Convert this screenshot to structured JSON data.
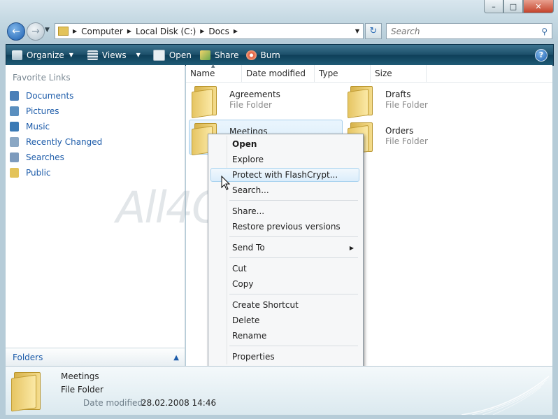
{
  "address": {
    "segments": [
      "Computer",
      "Local Disk (C:)",
      "Docs"
    ]
  },
  "search": {
    "placeholder": "Search"
  },
  "toolbar": {
    "organize": "Organize",
    "views": "Views",
    "open": "Open",
    "share": "Share",
    "burn": "Burn"
  },
  "nav": {
    "heading": "Favorite Links",
    "items": [
      {
        "label": "Documents",
        "icon": "documents-icon",
        "color": "#4a7fb8"
      },
      {
        "label": "Pictures",
        "icon": "pictures-icon",
        "color": "#5a8fbf"
      },
      {
        "label": "Music",
        "icon": "music-icon",
        "color": "#3b7ab5"
      },
      {
        "label": "Recently Changed",
        "icon": "recently-changed-icon",
        "color": "#8aa7c4"
      },
      {
        "label": "Searches",
        "icon": "searches-icon",
        "color": "#7d9bbd"
      },
      {
        "label": "Public",
        "icon": "public-folder-icon",
        "color": "#e3c35a"
      }
    ],
    "folders_label": "Folders"
  },
  "columns": [
    "Name",
    "Date modified",
    "Type",
    "Size"
  ],
  "files": [
    {
      "name": "Agreements",
      "type": "File Folder"
    },
    {
      "name": "Drafts",
      "type": "File Folder"
    },
    {
      "name": "Meetings",
      "type": "File Folder"
    },
    {
      "name": "Orders",
      "type": "File Folder"
    }
  ],
  "context_menu": {
    "open": "Open",
    "explore": "Explore",
    "protect": "Protect with FlashCrypt...",
    "search": "Search...",
    "share": "Share...",
    "restore": "Restore previous versions",
    "send_to": "Send To",
    "cut": "Cut",
    "copy": "Copy",
    "create_shortcut": "Create Shortcut",
    "delete": "Delete",
    "rename": "Rename",
    "properties": "Properties"
  },
  "watermark": "All4OS.RU",
  "details": {
    "name": "Meetings",
    "type": "File Folder",
    "date_label": "Date modified:",
    "date_value": "28.02.2008 14:46"
  }
}
